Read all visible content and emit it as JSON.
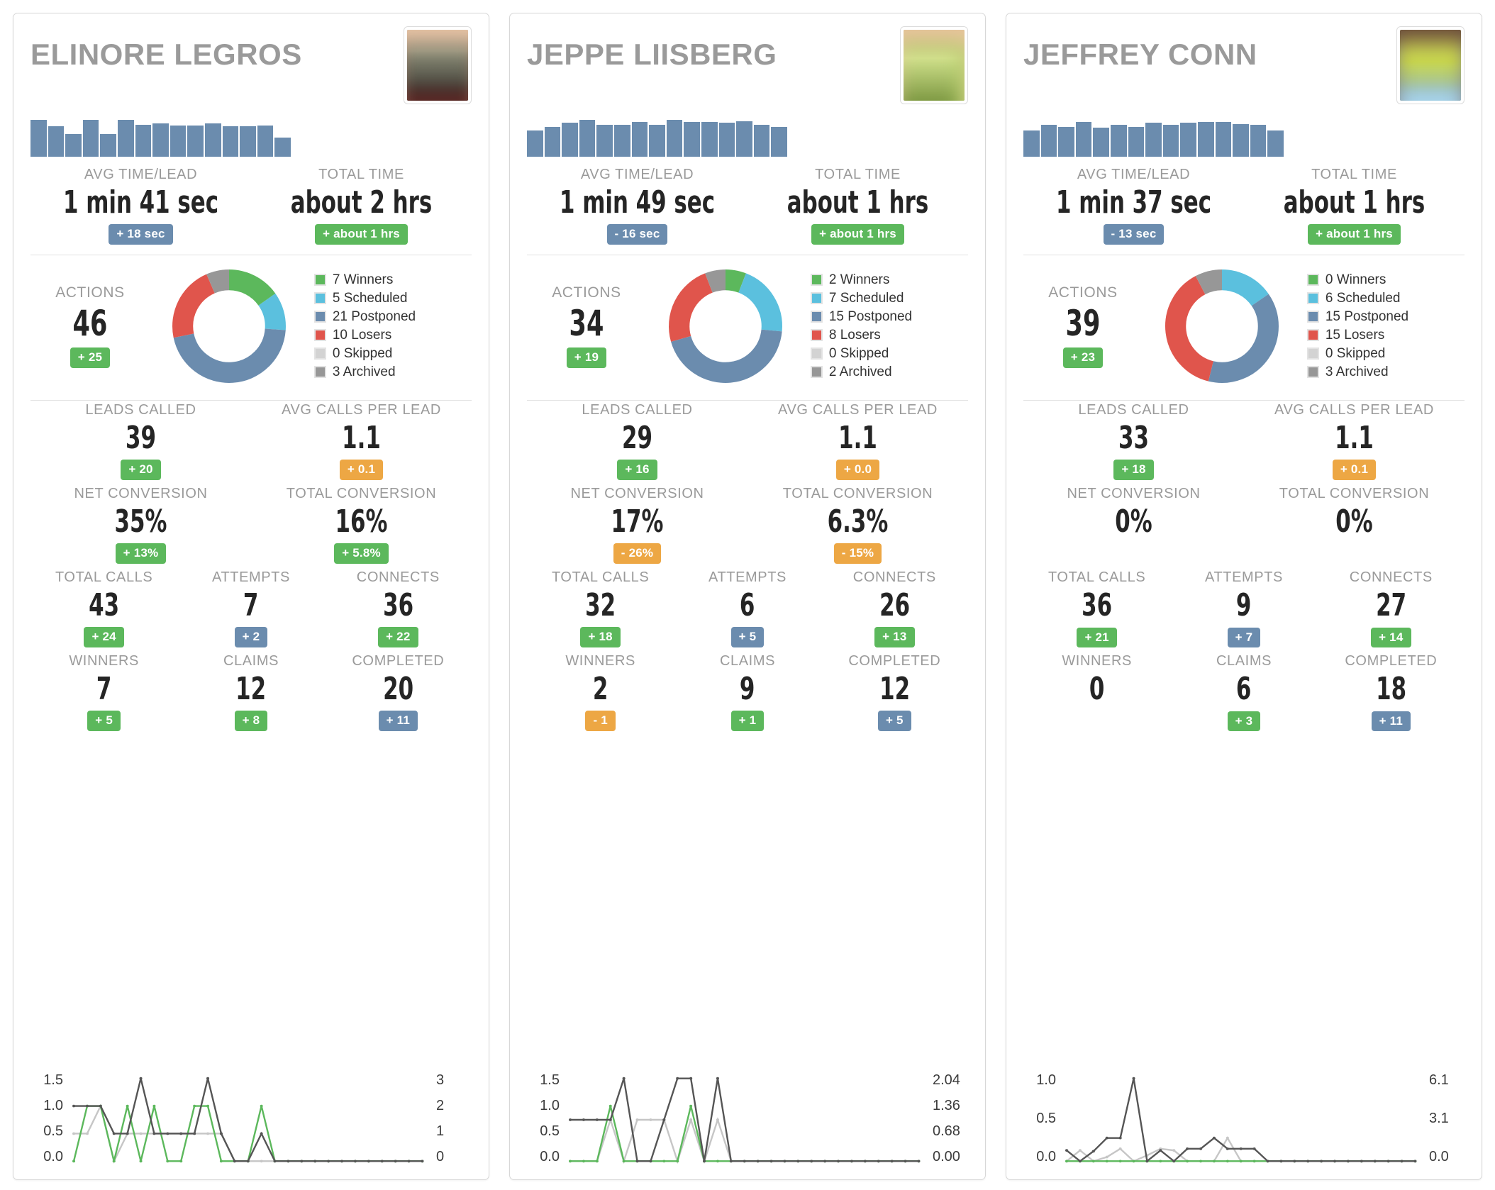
{
  "colors": {
    "green": "#5cb85c",
    "blue": "#6b8cae",
    "orange": "#eda744",
    "lightblue": "#5bc0de",
    "red": "#e0554c",
    "lightgray": "#d3d3d3",
    "darkgray": "#979797",
    "label": "#9a9a9a",
    "value": "#252525"
  },
  "labels": {
    "avg_time_lead": "AVG TIME/LEAD",
    "total_time": "TOTAL TIME",
    "actions": "ACTIONS",
    "leads_called": "LEADS CALLED",
    "avg_calls_per_lead": "AVG CALLS PER LEAD",
    "net_conversion": "NET CONVERSION",
    "total_conversion": "TOTAL CONVERSION",
    "total_calls": "TOTAL CALLS",
    "attempts": "ATTEMPTS",
    "connects": "CONNECTS",
    "winners": "WINNERS",
    "claims": "CLAIMS",
    "completed": "COMPLETED"
  },
  "cards": [
    {
      "name": "ELINORE LEGROS",
      "avatar": "asian-woman-photo",
      "sparkline": [
        1.0,
        0.82,
        0.62,
        1.0,
        0.62,
        1.0,
        0.86,
        0.9,
        0.85,
        0.84,
        0.9,
        0.82,
        0.82,
        0.84,
        0.52
      ],
      "avg_time_lead": {
        "value": "1 min 41 sec",
        "delta": "+ 18 sec",
        "delta_color": "blue"
      },
      "total_time": {
        "value": "about 2 hrs",
        "delta": "+ about 1 hrs",
        "delta_color": "green"
      },
      "actions": {
        "value": "46",
        "delta": "+ 25",
        "delta_color": "green"
      },
      "donut": [
        {
          "label": "7 Winners",
          "count": 7,
          "color": "#5cb85c"
        },
        {
          "label": "5 Scheduled",
          "count": 5,
          "color": "#5bc0de"
        },
        {
          "label": "21 Postponed",
          "count": 21,
          "color": "#6b8cae"
        },
        {
          "label": "10 Losers",
          "count": 10,
          "color": "#e0554c"
        },
        {
          "label": "0 Skipped",
          "count": 0,
          "color": "#d3d3d3"
        },
        {
          "label": "3 Archived",
          "count": 3,
          "color": "#979797"
        }
      ],
      "leads_called": {
        "value": "39",
        "delta": "+ 20",
        "delta_color": "green"
      },
      "avg_calls_per_lead": {
        "value": "1.1",
        "delta": "+ 0.1",
        "delta_color": "orange"
      },
      "net_conversion": {
        "value": "35%",
        "delta": "+ 13%",
        "delta_color": "green"
      },
      "total_conversion": {
        "value": "16%",
        "delta": "+ 5.8%",
        "delta_color": "green"
      },
      "total_calls": {
        "value": "43",
        "delta": "+ 24",
        "delta_color": "green"
      },
      "attempts": {
        "value": "7",
        "delta": "+ 2",
        "delta_color": "blue"
      },
      "connects": {
        "value": "36",
        "delta": "+ 22",
        "delta_color": "green"
      },
      "winners": {
        "value": "7",
        "delta": "+ 5",
        "delta_color": "green"
      },
      "claims": {
        "value": "12",
        "delta": "+ 8",
        "delta_color": "green"
      },
      "completed": {
        "value": "20",
        "delta": "+ 11",
        "delta_color": "blue"
      },
      "chart_data": {
        "type": "line",
        "title": "",
        "xlabel": "",
        "ylabel": "",
        "grid": false,
        "legend": "none",
        "y_left_ticks": [
          "1.5",
          "1.0",
          "0.5",
          "0.0"
        ],
        "y_right_ticks": [
          "3",
          "2",
          "1",
          "0"
        ],
        "ylim": [
          0,
          1.5
        ],
        "x": [
          0,
          1,
          2,
          3,
          4,
          5,
          6,
          7,
          8,
          9,
          10,
          11,
          12,
          13,
          14,
          15,
          16,
          17,
          18,
          19,
          20,
          21,
          22,
          23,
          24,
          25,
          26
        ],
        "series": [
          {
            "name": "green",
            "color": "#5cb85c",
            "values": [
              0.0,
              1.0,
              1.0,
              0.0,
              1.0,
              0.0,
              1.0,
              0.0,
              0.0,
              1.0,
              1.0,
              0.0,
              0.0,
              0.0,
              1.0,
              0.0,
              0.0,
              0.0,
              0.0,
              0.0,
              0.0,
              0.0,
              0.0,
              0.0,
              0.0,
              0.0,
              0.0
            ]
          },
          {
            "name": "dark-gray",
            "color": "#555555",
            "values": [
              1.0,
              1.0,
              1.0,
              0.5,
              0.5,
              1.5,
              0.5,
              0.5,
              0.5,
              0.5,
              1.5,
              0.5,
              0.0,
              0.0,
              0.5,
              0.0,
              0.0,
              0.0,
              0.0,
              0.0,
              0.0,
              0.0,
              0.0,
              0.0,
              0.0,
              0.0,
              0.0
            ]
          },
          {
            "name": "light-gray",
            "color": "#c6c6c6",
            "values": [
              0.5,
              0.5,
              1.0,
              0.0,
              0.5,
              0.5,
              0.5,
              0.5,
              0.5,
              0.5,
              0.5,
              0.5,
              0.0,
              0.0,
              0.0,
              0.0,
              0.0,
              0.0,
              0.0,
              0.0,
              0.0,
              0.0,
              0.0,
              0.0,
              0.0,
              0.0,
              0.0
            ]
          }
        ]
      }
    },
    {
      "name": "JEPPE LIISBERG",
      "avatar": "young-man-photo",
      "sparkline": [
        0.72,
        0.8,
        0.92,
        1.0,
        0.86,
        0.86,
        0.95,
        0.86,
        1.0,
        0.95,
        0.95,
        0.92,
        0.97,
        0.86,
        0.8
      ],
      "avg_time_lead": {
        "value": "1 min 49 sec",
        "delta": "- 16 sec",
        "delta_color": "blue"
      },
      "total_time": {
        "value": "about 1 hrs",
        "delta": "+ about 1 hrs",
        "delta_color": "green"
      },
      "actions": {
        "value": "34",
        "delta": "+ 19",
        "delta_color": "green"
      },
      "donut": [
        {
          "label": "2 Winners",
          "count": 2,
          "color": "#5cb85c"
        },
        {
          "label": "7 Scheduled",
          "count": 7,
          "color": "#5bc0de"
        },
        {
          "label": "15 Postponed",
          "count": 15,
          "color": "#6b8cae"
        },
        {
          "label": "8 Losers",
          "count": 8,
          "color": "#e0554c"
        },
        {
          "label": "0 Skipped",
          "count": 0,
          "color": "#d3d3d3"
        },
        {
          "label": "2 Archived",
          "count": 2,
          "color": "#979797"
        }
      ],
      "leads_called": {
        "value": "29",
        "delta": "+ 16",
        "delta_color": "green"
      },
      "avg_calls_per_lead": {
        "value": "1.1",
        "delta": "+ 0.0",
        "delta_color": "orange"
      },
      "net_conversion": {
        "value": "17%",
        "delta": "- 26%",
        "delta_color": "orange"
      },
      "total_conversion": {
        "value": "6.3%",
        "delta": "- 15%",
        "delta_color": "orange"
      },
      "total_calls": {
        "value": "32",
        "delta": "+ 18",
        "delta_color": "green"
      },
      "attempts": {
        "value": "6",
        "delta": "+ 5",
        "delta_color": "blue"
      },
      "connects": {
        "value": "26",
        "delta": "+ 13",
        "delta_color": "green"
      },
      "winners": {
        "value": "2",
        "delta": "- 1",
        "delta_color": "orange"
      },
      "claims": {
        "value": "9",
        "delta": "+ 1",
        "delta_color": "green"
      },
      "completed": {
        "value": "12",
        "delta": "+ 5",
        "delta_color": "blue"
      },
      "chart_data": {
        "type": "line",
        "title": "",
        "xlabel": "",
        "ylabel": "",
        "grid": false,
        "legend": "none",
        "y_left_ticks": [
          "1.5",
          "1.0",
          "0.5",
          "0.0"
        ],
        "y_right_ticks": [
          "2.04",
          "1.36",
          "0.68",
          "0.00"
        ],
        "ylim": [
          0,
          1.5
        ],
        "x": [
          0,
          1,
          2,
          3,
          4,
          5,
          6,
          7,
          8,
          9,
          10,
          11,
          12,
          13,
          14,
          15,
          16,
          17,
          18,
          19,
          20,
          21,
          22,
          23,
          24,
          25,
          26
        ],
        "series": [
          {
            "name": "green",
            "color": "#5cb85c",
            "values": [
              0.0,
              0.0,
              0.0,
              1.0,
              0.0,
              0.0,
              0.0,
              0.0,
              0.0,
              1.0,
              0.0,
              0.0,
              0.0,
              0.0,
              0.0,
              0.0,
              0.0,
              0.0,
              0.0,
              0.0,
              0.0,
              0.0,
              0.0,
              0.0,
              0.0,
              0.0,
              0.0
            ]
          },
          {
            "name": "dark-gray",
            "color": "#555555",
            "values": [
              0.75,
              0.75,
              0.75,
              0.75,
              1.5,
              0.0,
              0.0,
              0.75,
              1.5,
              1.5,
              0.0,
              1.5,
              0.0,
              0.0,
              0.0,
              0.0,
              0.0,
              0.0,
              0.0,
              0.0,
              0.0,
              0.0,
              0.0,
              0.0,
              0.0,
              0.0,
              0.0
            ]
          },
          {
            "name": "light-gray",
            "color": "#c6c6c6",
            "values": [
              0.0,
              0.0,
              0.0,
              0.75,
              0.0,
              0.75,
              0.75,
              0.75,
              0.0,
              0.75,
              0.0,
              0.75,
              0.0,
              0.0,
              0.0,
              0.0,
              0.0,
              0.0,
              0.0,
              0.0,
              0.0,
              0.0,
              0.0,
              0.0,
              0.0,
              0.0,
              0.0
            ]
          }
        ]
      }
    },
    {
      "name": "JEFFREY CONN",
      "avatar": "bald-man-photo",
      "sparkline": [
        0.72,
        0.86,
        0.8,
        0.95,
        0.78,
        0.86,
        0.8,
        0.92,
        0.86,
        0.92,
        0.95,
        0.95,
        0.88,
        0.86,
        0.72
      ],
      "avg_time_lead": {
        "value": "1 min 37 sec",
        "delta": "- 13 sec",
        "delta_color": "blue"
      },
      "total_time": {
        "value": "about 1 hrs",
        "delta": "+ about 1 hrs",
        "delta_color": "green"
      },
      "actions": {
        "value": "39",
        "delta": "+ 23",
        "delta_color": "green"
      },
      "donut": [
        {
          "label": "0 Winners",
          "count": 0,
          "color": "#5cb85c"
        },
        {
          "label": "6 Scheduled",
          "count": 6,
          "color": "#5bc0de"
        },
        {
          "label": "15 Postponed",
          "count": 15,
          "color": "#6b8cae"
        },
        {
          "label": "15 Losers",
          "count": 15,
          "color": "#e0554c"
        },
        {
          "label": "0 Skipped",
          "count": 0,
          "color": "#d3d3d3"
        },
        {
          "label": "3 Archived",
          "count": 3,
          "color": "#979797"
        }
      ],
      "leads_called": {
        "value": "33",
        "delta": "+ 18",
        "delta_color": "green"
      },
      "avg_calls_per_lead": {
        "value": "1.1",
        "delta": "+ 0.1",
        "delta_color": "orange"
      },
      "net_conversion": {
        "value": "0%",
        "delta": "",
        "delta_color": "none"
      },
      "total_conversion": {
        "value": "0%",
        "delta": "",
        "delta_color": "none"
      },
      "total_calls": {
        "value": "36",
        "delta": "+ 21",
        "delta_color": "green"
      },
      "attempts": {
        "value": "9",
        "delta": "+ 7",
        "delta_color": "blue"
      },
      "connects": {
        "value": "27",
        "delta": "+ 14",
        "delta_color": "green"
      },
      "winners": {
        "value": "0",
        "delta": "",
        "delta_color": "none"
      },
      "claims": {
        "value": "6",
        "delta": "+ 3",
        "delta_color": "green"
      },
      "completed": {
        "value": "18",
        "delta": "+ 11",
        "delta_color": "blue"
      },
      "chart_data": {
        "type": "line",
        "title": "",
        "xlabel": "",
        "ylabel": "",
        "grid": false,
        "legend": "none",
        "y_left_ticks": [
          "1.0",
          "0.5",
          "0.0"
        ],
        "y_right_ticks": [
          "6.1",
          "3.1",
          "0.0"
        ],
        "ylim": [
          0,
          1.0
        ],
        "x": [
          0,
          1,
          2,
          3,
          4,
          5,
          6,
          7,
          8,
          9,
          10,
          11,
          12,
          13,
          14,
          15,
          16,
          17,
          18,
          19,
          20,
          21,
          22,
          23,
          24,
          25,
          26
        ],
        "series": [
          {
            "name": "green",
            "color": "#5cb85c",
            "values": [
              0.0,
              0.0,
              0.0,
              0.0,
              0.0,
              0.0,
              0.0,
              0.0,
              0.0,
              0.0,
              0.0,
              0.0,
              0.0,
              0.0,
              0.0,
              0.0,
              0.0,
              0.0,
              0.0,
              0.0,
              0.0,
              0.0,
              0.0,
              0.0,
              0.0,
              0.0,
              0.0
            ]
          },
          {
            "name": "dark-gray",
            "color": "#555555",
            "values": [
              0.13,
              0.0,
              0.12,
              0.28,
              0.28,
              1.0,
              0.0,
              0.13,
              0.0,
              0.15,
              0.15,
              0.28,
              0.15,
              0.15,
              0.15,
              0.0,
              0.0,
              0.0,
              0.0,
              0.0,
              0.0,
              0.0,
              0.0,
              0.0,
              0.0,
              0.0,
              0.0
            ]
          },
          {
            "name": "light-gray",
            "color": "#c6c6c6",
            "values": [
              0.0,
              0.13,
              0.0,
              0.05,
              0.15,
              0.0,
              0.07,
              0.15,
              0.13,
              0.0,
              0.0,
              0.0,
              0.28,
              0.0,
              0.0,
              0.0,
              0.0,
              0.0,
              0.0,
              0.0,
              0.0,
              0.0,
              0.0,
              0.0,
              0.0,
              0.0,
              0.0
            ]
          }
        ]
      }
    }
  ]
}
